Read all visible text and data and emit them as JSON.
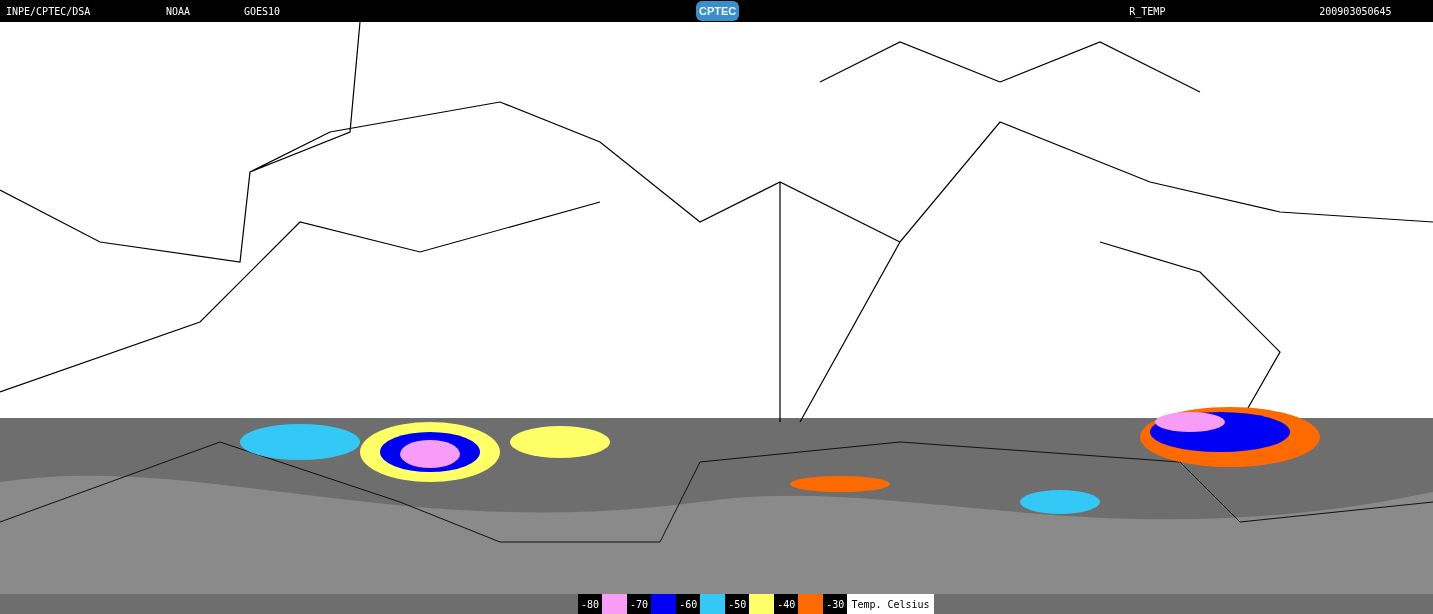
{
  "header": {
    "source": "INPE/CPTEC/DSA",
    "agency": "NOAA",
    "satellite": "GOES10",
    "logo": "CPTEC",
    "product": "R_TEMP",
    "timestamp": "200903050645"
  },
  "legend": {
    "items": [
      {
        "label": "-80",
        "color": "#f79cf7"
      },
      {
        "label": "-70",
        "color": "#0000f5"
      },
      {
        "label": "-60",
        "color": "#33c8f5"
      },
      {
        "label": "-50",
        "color": "#ffff66"
      },
      {
        "label": "-40",
        "color": "#ff6a00"
      },
      {
        "label": "-30"
      }
    ],
    "unit": "Temp. Celsius"
  }
}
